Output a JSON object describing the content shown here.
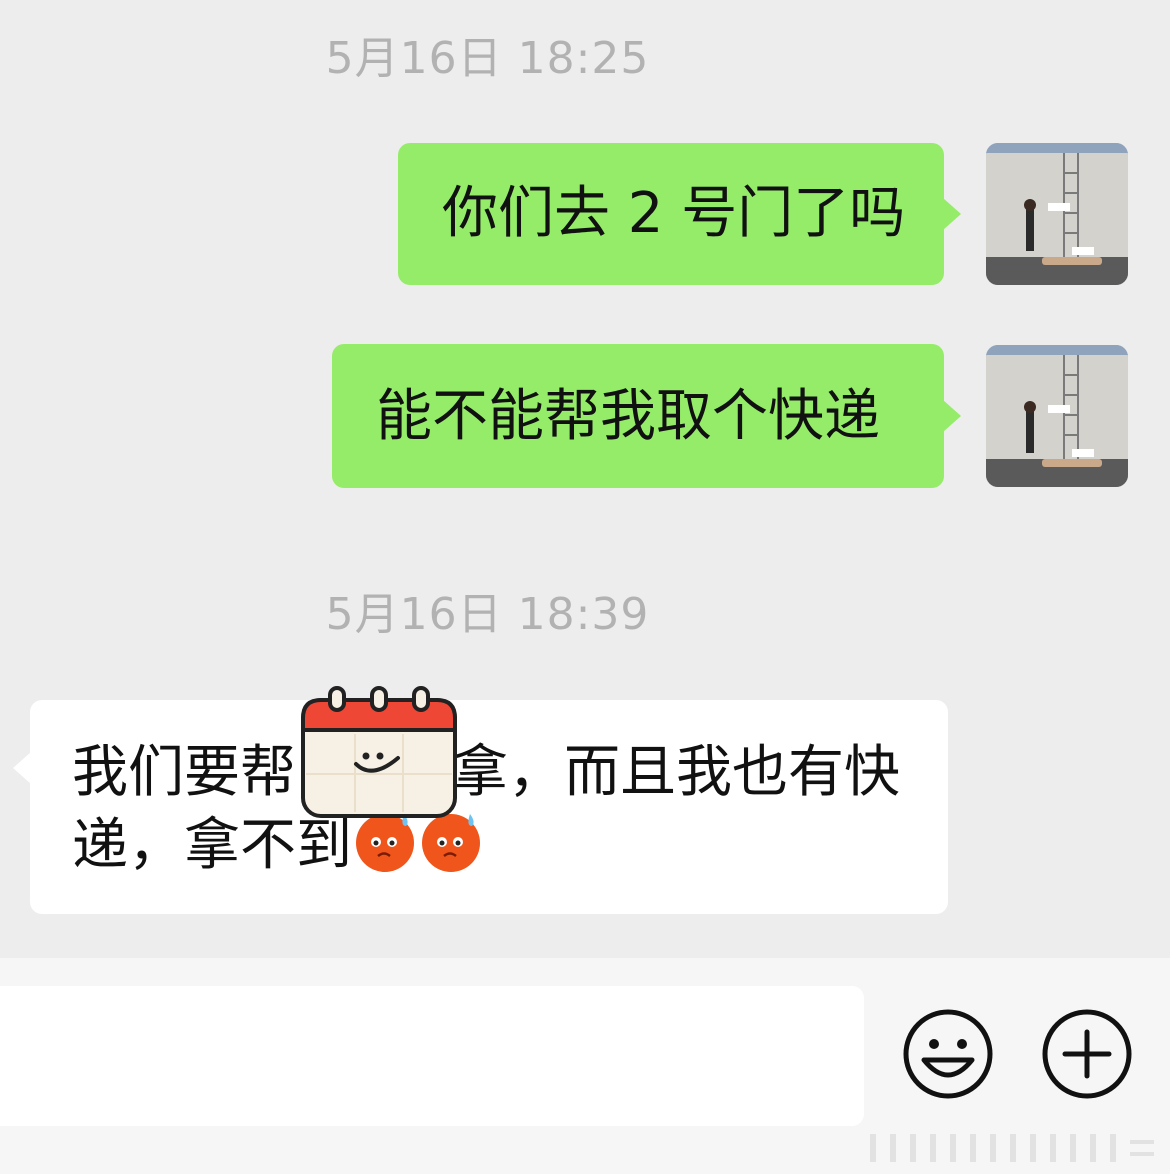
{
  "chat": {
    "timestamp_1": "5月16日 18:25",
    "timestamp_2": "5月16日 18:39",
    "messages": [
      {
        "side": "right",
        "text": "你们去 2 号门了吗"
      },
      {
        "side": "right",
        "text": "能不能帮我取个快递"
      },
      {
        "side": "left",
        "line1_a": "我们要帮",
        "line1_b": "拿，而且我也有快",
        "line2": "递，拿不到"
      }
    ],
    "inline_emoji": "sweating-sad-face-icon",
    "sticker": "calendar-smile-sticker"
  },
  "input_bar": {
    "emoji_button": "smiley-icon",
    "plus_button": "plus-icon"
  },
  "colors": {
    "background": "#ededed",
    "outgoing_bubble": "#95ec69",
    "incoming_bubble": "#ffffff",
    "timestamp_text": "#b2b2b2"
  }
}
